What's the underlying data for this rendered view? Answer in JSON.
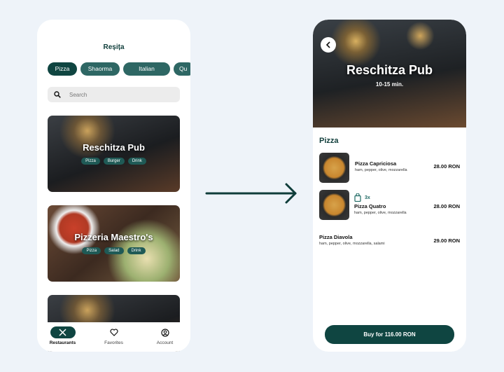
{
  "left": {
    "title": "Reșița",
    "categories": [
      "Pizza",
      "Shaorma",
      "Italian",
      "Qu"
    ],
    "search_placeholder": "Search",
    "restaurants": [
      {
        "name": "Reschitza Pub",
        "tags": [
          "Pizza",
          "Burger",
          "Drink"
        ]
      },
      {
        "name": "Pizzeria Maestro's",
        "tags": [
          "Pizza",
          "Salad",
          "Drink"
        ]
      }
    ],
    "nav": [
      {
        "label": "Restaurants",
        "icon": "fork-knife-icon"
      },
      {
        "label": "Favorites",
        "icon": "heart-icon"
      },
      {
        "label": "Account",
        "icon": "user-circle-icon"
      }
    ]
  },
  "right": {
    "restaurant": "Reschitza Pub",
    "time": "10-15 min.",
    "section": "Pizza",
    "items": [
      {
        "name": "Pizza Capriciosa",
        "desc": "ham, pepper, olive, mozzarella",
        "price": "28.00 RON"
      },
      {
        "name": "Pizza Quatro",
        "desc": "ham, pepper, olive, mozzarella",
        "price": "28.00 RON",
        "qty": "3x"
      },
      {
        "name": "Pizza Diavola",
        "desc": "ham, pepper, olive, mozzarella, salami",
        "price": "29.00 RON"
      }
    ],
    "buy_label": "Buy for 116.00 RON"
  },
  "colors": {
    "accent": "#0f4541",
    "chip": "#2e6764",
    "background": "#eef3f9"
  }
}
